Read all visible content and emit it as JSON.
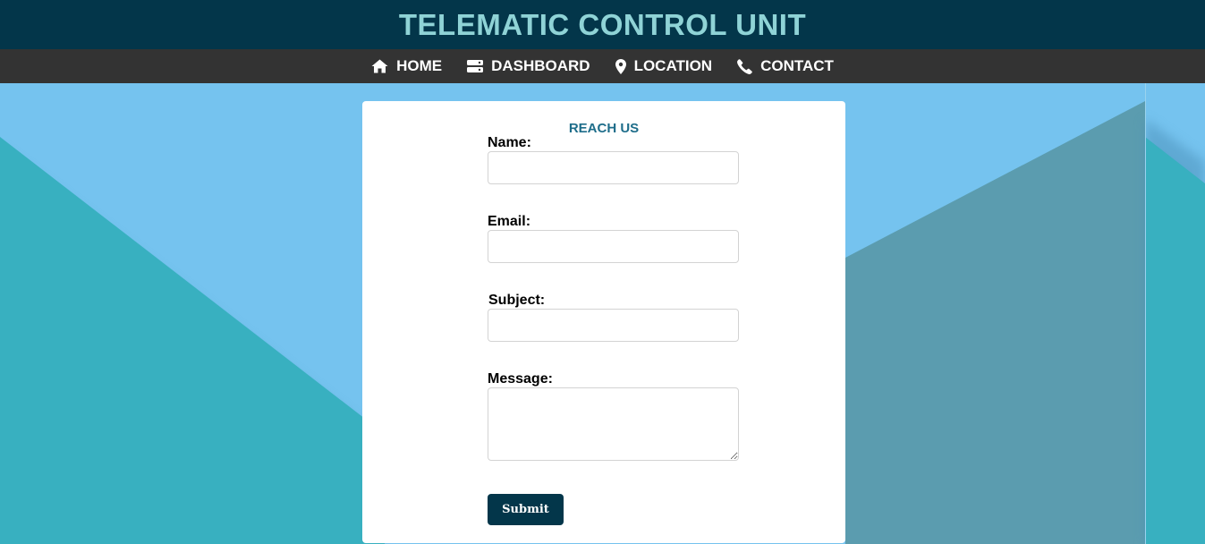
{
  "header": {
    "title": "TELEMATIC CONTROL UNIT",
    "title_color": "#8fd3d6",
    "background_color": "#03364a"
  },
  "nav": {
    "background_color": "#333333",
    "items": [
      {
        "label": "HOME",
        "icon": "home-icon"
      },
      {
        "label": "DASHBOARD",
        "icon": "server-icon"
      },
      {
        "label": "LOCATION",
        "icon": "map-pin-icon"
      },
      {
        "label": "CONTACT",
        "icon": "phone-icon"
      }
    ]
  },
  "form": {
    "title": "REACH US",
    "name_label": "Name:",
    "name_value": "",
    "email_label": "Email:",
    "email_value": "",
    "subject_label": "Subject:",
    "subject_value": "",
    "message_label": "Message:",
    "message_value": "",
    "submit_label": "Submit",
    "button_color": "#03364a"
  },
  "colors": {
    "sky": "#75c3ef",
    "teal": "#38b0c0",
    "slate": "#5b9caf"
  }
}
